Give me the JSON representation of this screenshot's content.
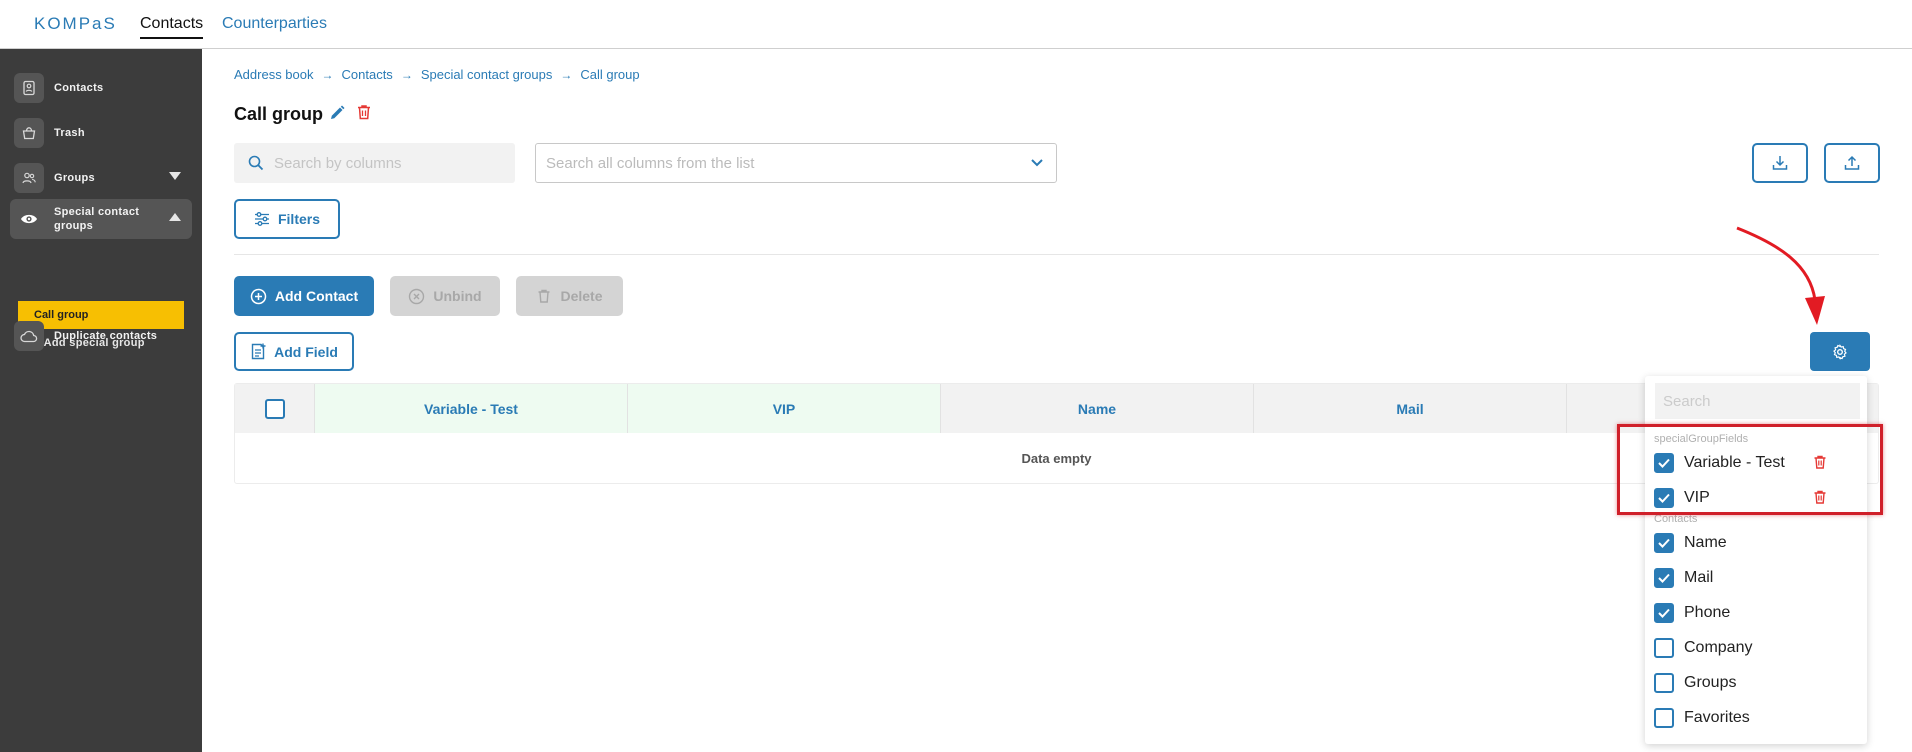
{
  "topbar": {
    "logo": "KOMPaS",
    "nav": [
      {
        "label": "Contacts",
        "active": true
      },
      {
        "label": "Counterparties",
        "active": false
      }
    ]
  },
  "sidebar": {
    "items": [
      {
        "label": "Contacts",
        "icon": "contact-card-icon"
      },
      {
        "label": "Trash",
        "icon": "trash-basket-icon"
      },
      {
        "label": "Groups",
        "icon": "users-group-icon"
      },
      {
        "label": "Special contact groups",
        "icon": "eye-icon"
      },
      {
        "label": "Duplicate contacts",
        "icon": "cloud-icon"
      }
    ],
    "sub_items": {
      "active": "Call group",
      "add": "+ Add special group"
    }
  },
  "breadcrumb": [
    "Address book",
    "Contacts",
    "Special contact groups",
    "Call group"
  ],
  "page": {
    "title": "Call group"
  },
  "toolbar": {
    "search_placeholder": "Search by columns",
    "select_placeholder": "Search all columns from the list",
    "filters_label": "Filters",
    "add_contact_label": "Add Contact",
    "unbind_label": "Unbind",
    "delete_label": "Delete",
    "add_field_label": "Add Field"
  },
  "table": {
    "columns": [
      "Variable - Test",
      "VIP",
      "Name",
      "Mail"
    ],
    "empty_text": "Data empty"
  },
  "column_menu": {
    "search_placeholder": "Search",
    "groups": [
      {
        "title": "specialGroupFields",
        "items": [
          {
            "label": "Variable - Test",
            "checked": true,
            "deletable": true
          },
          {
            "label": "VIP",
            "checked": true,
            "deletable": true
          }
        ]
      },
      {
        "title": "Contacts",
        "items": [
          {
            "label": "Name",
            "checked": true
          },
          {
            "label": "Mail",
            "checked": true
          },
          {
            "label": "Phone",
            "checked": true
          },
          {
            "label": "Company",
            "checked": false
          },
          {
            "label": "Groups",
            "checked": false
          },
          {
            "label": "Favorites",
            "checked": false
          }
        ]
      }
    ]
  },
  "colors": {
    "primary": "#2a7bb5",
    "sidebar_bg": "#3c3c3c",
    "active_sub": "#f7bf02",
    "danger": "#e53935",
    "highlight": "#d0202a"
  }
}
